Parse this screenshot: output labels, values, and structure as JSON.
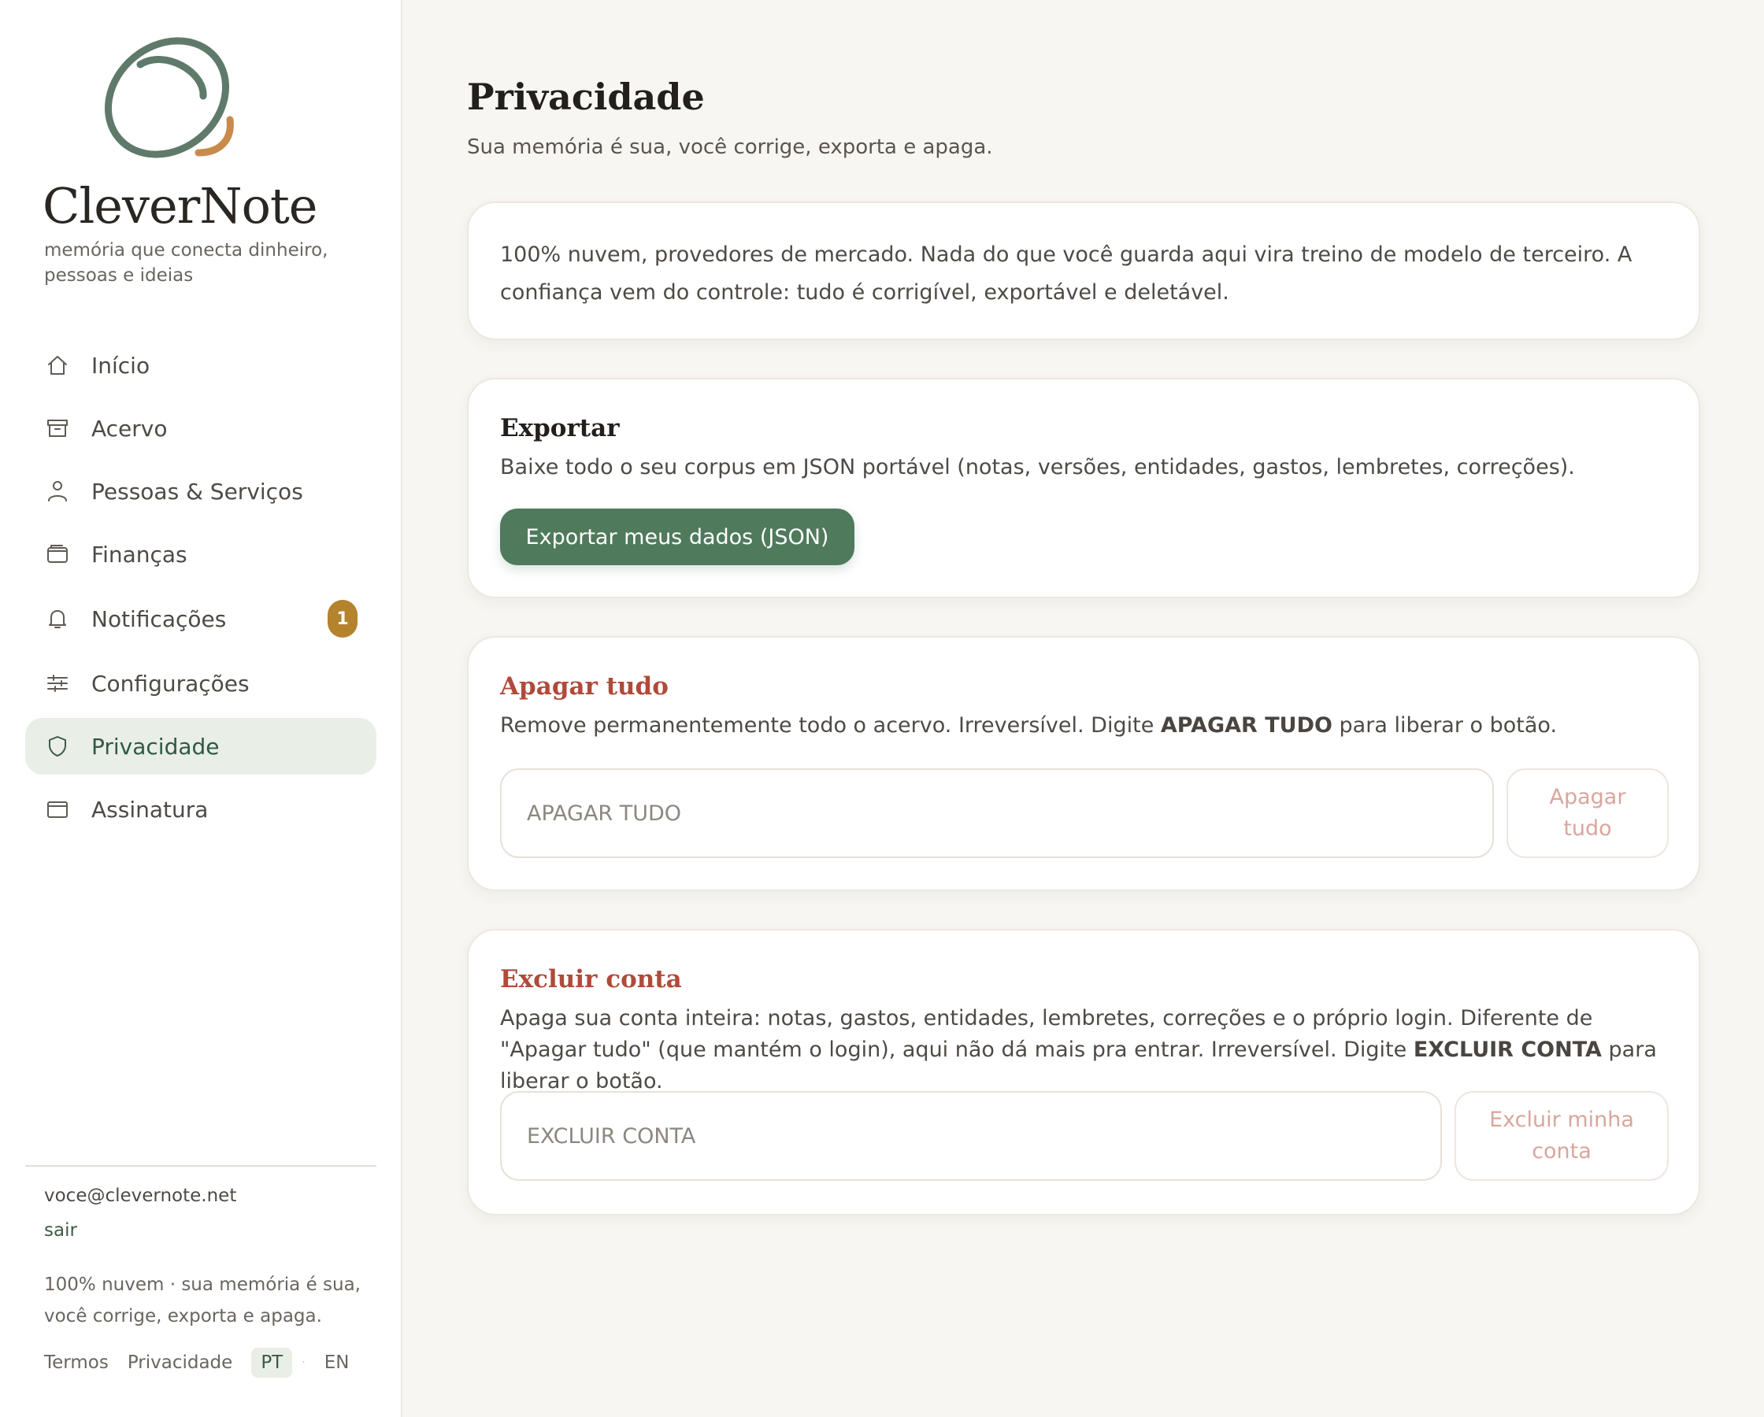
{
  "brand": {
    "name": "CleverNote",
    "tagline": "memória que conecta dinheiro, pessoas e ideias",
    "colors": {
      "accent_green": "#4f7a5c",
      "logo_green": "#5f7a6a",
      "logo_orange": "#c98a4b",
      "danger": "#b04a3a",
      "badge": "#b5822e"
    }
  },
  "sidebar": {
    "items": [
      {
        "label": "Início",
        "icon": "home-icon",
        "active": false
      },
      {
        "label": "Acervo",
        "icon": "archive-icon",
        "active": false
      },
      {
        "label": "Pessoas & Serviços",
        "icon": "person-icon",
        "active": false
      },
      {
        "label": "Finanças",
        "icon": "wallet-icon",
        "active": false
      },
      {
        "label": "Notificações",
        "icon": "bell-icon",
        "active": false,
        "badge": "1"
      },
      {
        "label": "Configurações",
        "icon": "sliders-icon",
        "active": false
      },
      {
        "label": "Privacidade",
        "icon": "shield-icon",
        "active": true
      },
      {
        "label": "Assinatura",
        "icon": "card-icon",
        "active": false
      }
    ],
    "user_email": "voce@clevernote.net",
    "logout_label": "sair",
    "footer_note": "100% nuvem · sua memória é sua, você corrige, exporta e apaga.",
    "links": {
      "terms": "Termos",
      "privacy": "Privacidade"
    },
    "languages": [
      {
        "code": "PT",
        "active": true
      },
      {
        "code": "EN",
        "active": false
      }
    ],
    "language_separator": "·"
  },
  "main": {
    "title": "Privacidade",
    "subtitle": "Sua memória é sua, você corrige, exporta e apaga.",
    "info_text": "100% nuvem, provedores de mercado. Nada do que você guarda aqui vira treino de modelo de terceiro. A confiança vem do controle: tudo é corrigível, exportável e deletável.",
    "export": {
      "title": "Exportar",
      "description": "Baixe todo o seu corpus em JSON portável (notas, versões, entidades, gastos, lembretes, correções).",
      "button_label": "Exportar meus dados (JSON)"
    },
    "erase": {
      "title": "Apagar tudo",
      "description_before": "Remove permanentemente todo o acervo. Irreversível. Digite ",
      "keyword": "APAGAR TUDO",
      "description_after": " para liberar o botão.",
      "input_placeholder": "APAGAR TUDO",
      "input_value": "",
      "button_label": "Apagar tudo"
    },
    "delete_account": {
      "title": "Excluir conta",
      "description_before": "Apaga sua conta inteira: notas, gastos, entidades, lembretes, correções e o próprio login. Diferente de \"Apagar tudo\" (que mantém o login), aqui não dá mais pra entrar. Irreversível. Digite ",
      "keyword": "EXCLUIR CONTA",
      "description_after": " para liberar o botão.",
      "input_placeholder": "EXCLUIR CONTA",
      "input_value": "",
      "button_label": "Excluir minha conta"
    }
  }
}
